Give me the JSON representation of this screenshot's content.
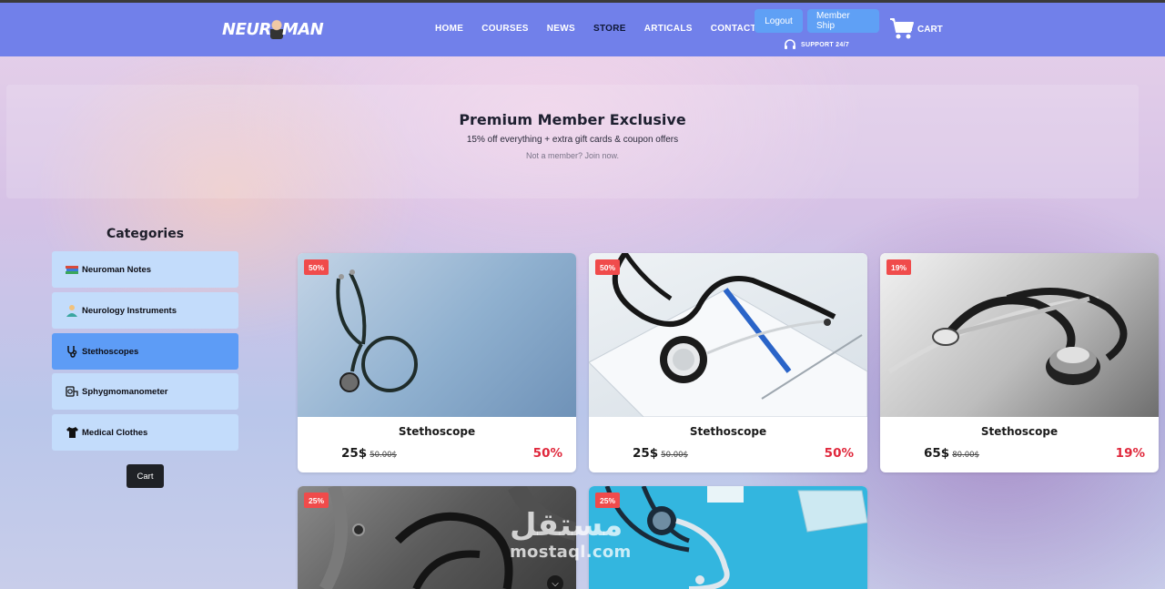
{
  "header": {
    "logo_text": "NEUROMAN",
    "nav": [
      "HOME",
      "COURSES",
      "NEWS",
      "STORE",
      "ARTICALS",
      "CONTACT US"
    ],
    "active_nav": "STORE",
    "logout_label": "Logout",
    "membership_label": "Member Ship",
    "support_label": "SUPPORT 24/7",
    "cart_label": "CART"
  },
  "banner": {
    "title": "Premium Member Exclusive",
    "subtitle": "15% off everything + extra gift cards & coupon offers",
    "join_text": "Not a member? Join now."
  },
  "sidebar": {
    "title": "Categories",
    "items": [
      {
        "label": "Neuroman Notes",
        "icon": "books-icon"
      },
      {
        "label": "Neurology Instruments",
        "icon": "doctor-icon"
      },
      {
        "label": "Stethoscopes",
        "icon": "stethoscope-icon",
        "active": true
      },
      {
        "label": "Sphygmomanometer",
        "icon": "blood-pressure-icon"
      },
      {
        "label": "Medical Clothes",
        "icon": "shirt-icon"
      }
    ],
    "cart_label": "Cart"
  },
  "products": [
    {
      "name": "Stethoscope",
      "price": "25$",
      "old_price": "50.00$",
      "discount": "50%",
      "badge": "50%"
    },
    {
      "name": "Stethoscope",
      "price": "25$",
      "old_price": "50.00$",
      "discount": "50%",
      "badge": "50%"
    },
    {
      "name": "Stethoscope",
      "price": "65$",
      "old_price": "80.00$",
      "discount": "19%",
      "badge": "19%"
    },
    {
      "badge": "25%"
    },
    {
      "badge": "25%"
    }
  ],
  "watermark": {
    "arabic": "مستقل",
    "latin": "mostaql.com"
  },
  "colors": {
    "navbar": "#7180ea",
    "button_blue": "#5fa0f5",
    "category_bg": "#c3dcfb",
    "category_active": "#5d9cf6",
    "badge_red": "#f04b4b",
    "discount_red": "#e0283c"
  }
}
